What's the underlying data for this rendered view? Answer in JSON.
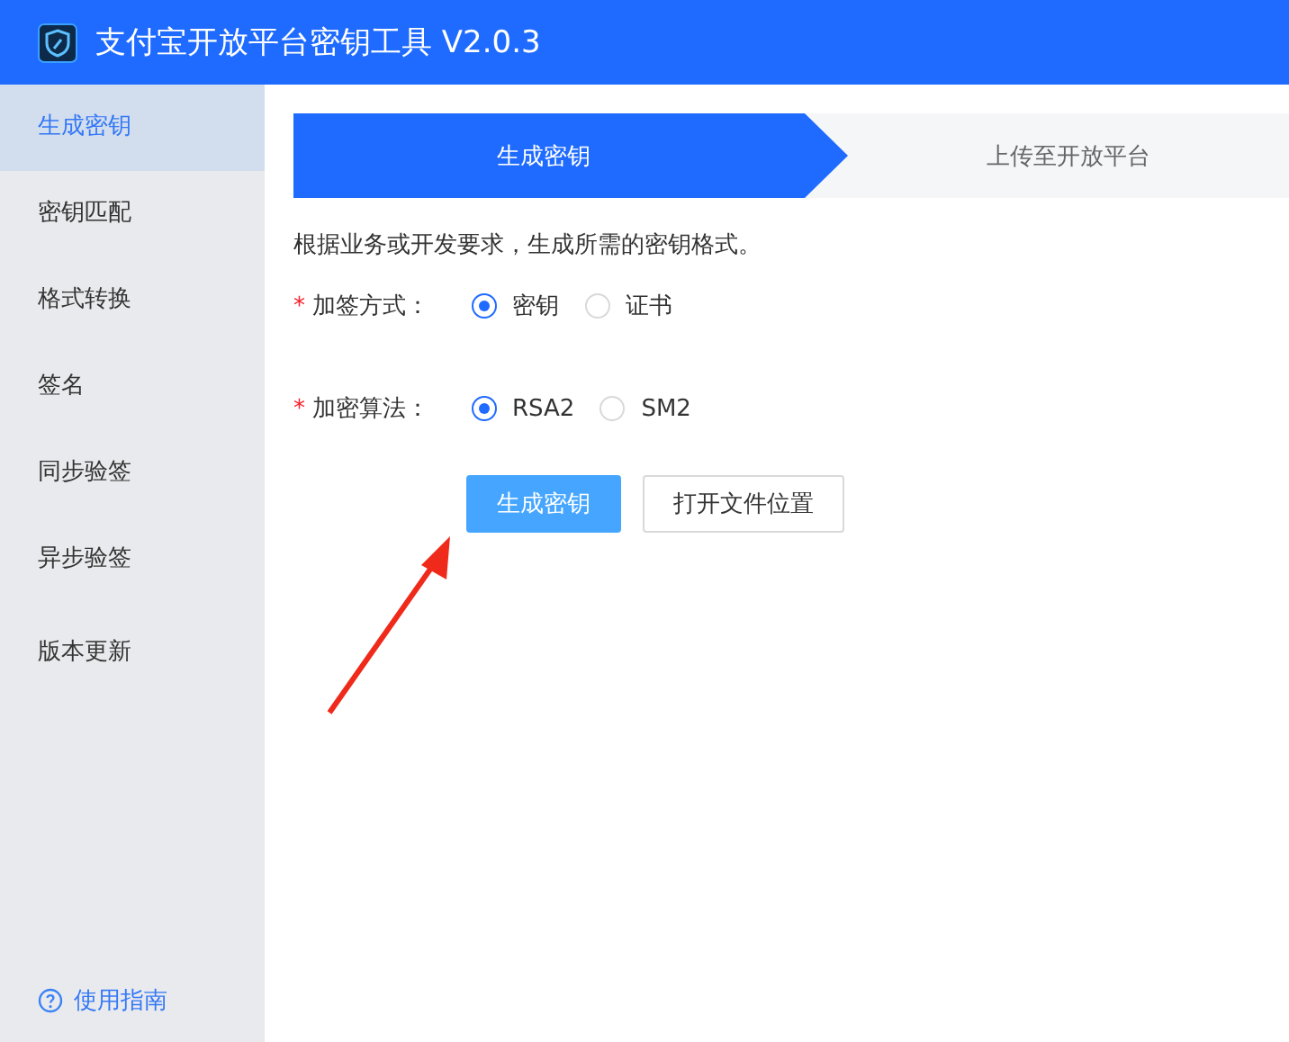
{
  "window": {
    "title": "支付宝开放平台密钥工具 V2.0.3"
  },
  "sidebar": {
    "items": [
      {
        "label": "生成密钥",
        "selected": true
      },
      {
        "label": "密钥匹配",
        "selected": false
      },
      {
        "label": "格式转换",
        "selected": false
      },
      {
        "label": "签名",
        "selected": false
      },
      {
        "label": "同步验签",
        "selected": false
      },
      {
        "label": "异步验签",
        "selected": false
      },
      {
        "label": "版本更新",
        "selected": false
      }
    ],
    "help_link": "使用指南"
  },
  "steps": [
    {
      "label": "生成密钥",
      "selected": true
    },
    {
      "label": "上传至开放平台",
      "selected": false
    }
  ],
  "description": "根据业务或开发要求，生成所需的密钥格式。",
  "fields": [
    {
      "required_mark": "*",
      "label": "加签方式：",
      "options": [
        {
          "label": "密钥",
          "selected": true
        },
        {
          "label": "证书",
          "selected": false
        }
      ]
    },
    {
      "required_mark": "*",
      "label": "加密算法：",
      "options": [
        {
          "label": "RSA2",
          "selected": true
        },
        {
          "label": "SM2",
          "selected": false
        }
      ]
    }
  ],
  "buttons": [
    {
      "label": "生成密钥",
      "kind": "primary"
    },
    {
      "label": "打开文件位置",
      "kind": "default"
    }
  ]
}
